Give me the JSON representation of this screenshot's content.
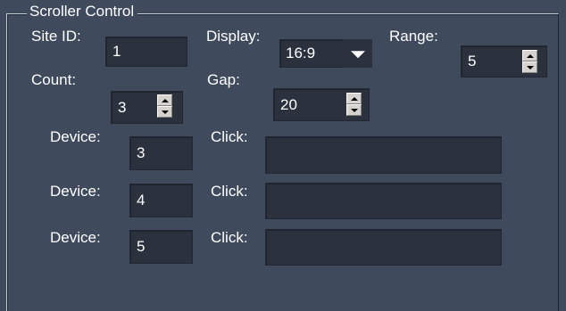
{
  "group": {
    "title": "Scroller Control"
  },
  "site_id": {
    "label": "Site ID:",
    "value": "1"
  },
  "display": {
    "label": "Display:",
    "value": "16:9",
    "dropdown_icon": "chevron-down-icon"
  },
  "range": {
    "label": "Range:",
    "value": "5"
  },
  "count": {
    "label": "Count:",
    "value": "3"
  },
  "gap": {
    "label": "Gap:",
    "value": "20"
  },
  "devices": [
    {
      "device_label": "Device:",
      "device_value": "3",
      "click_label": "Click:",
      "click_value": ""
    },
    {
      "device_label": "Device:",
      "device_value": "4",
      "click_label": "Click:",
      "click_value": ""
    },
    {
      "device_label": "Device:",
      "device_value": "5",
      "click_label": "Click:",
      "click_value": ""
    }
  ],
  "colors": {
    "background": "#3f4a5c",
    "field_background": "#2b323e",
    "text": "#ffffff",
    "spin_button": "#d6d3ce"
  }
}
